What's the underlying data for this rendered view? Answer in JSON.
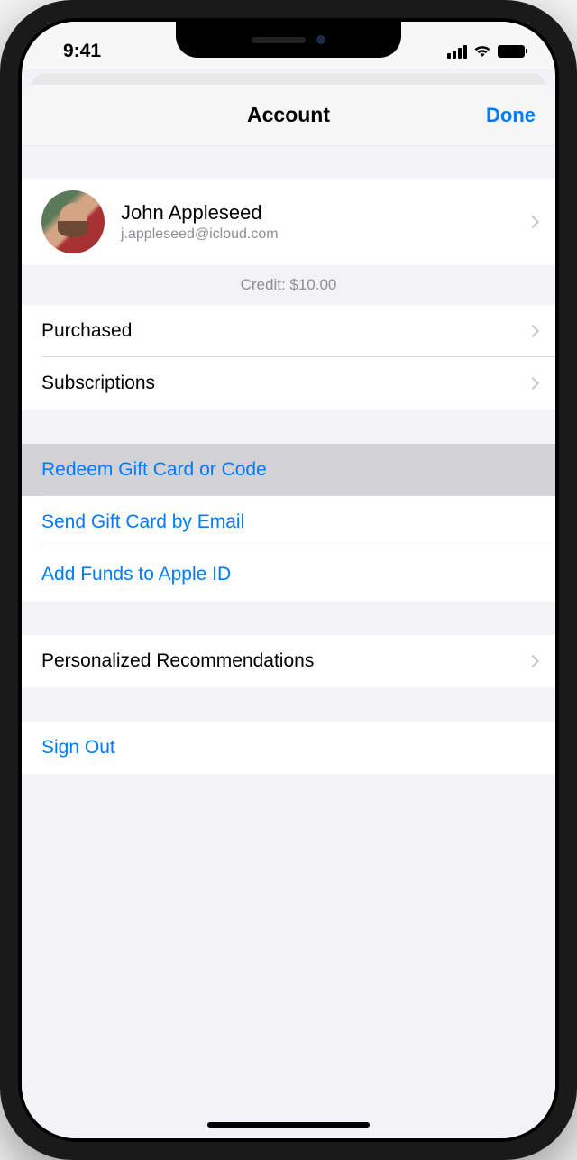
{
  "statusBar": {
    "time": "9:41"
  },
  "header": {
    "title": "Account",
    "done": "Done"
  },
  "profile": {
    "name": "John Appleseed",
    "email": "j.appleseed@icloud.com"
  },
  "credit": "Credit: $10.00",
  "rows": {
    "purchased": "Purchased",
    "subscriptions": "Subscriptions",
    "redeem": "Redeem Gift Card or Code",
    "sendGift": "Send Gift Card by Email",
    "addFunds": "Add Funds to Apple ID",
    "personalized": "Personalized Recommendations",
    "signOut": "Sign Out"
  }
}
